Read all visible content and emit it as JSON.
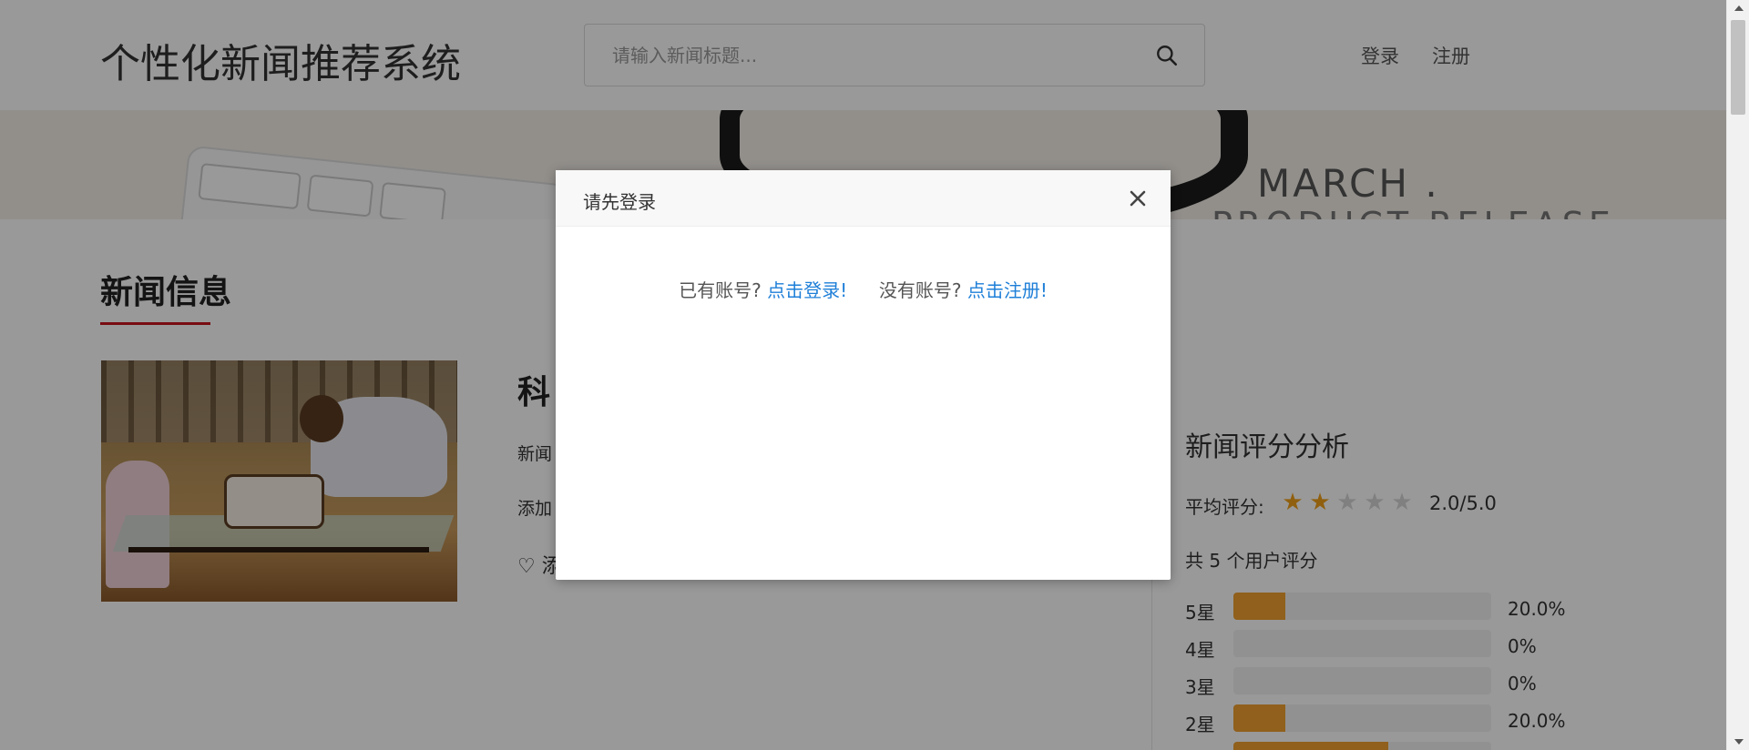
{
  "header": {
    "site_title": "个性化新闻推荐系统",
    "search_placeholder": "请输入新闻标题...",
    "nav": {
      "login": "登录",
      "register": "注册"
    }
  },
  "banner": {
    "line1": "MARCH .",
    "line2": "PRODUCT RELEASE"
  },
  "main": {
    "section_title": "新闻信息",
    "headline_partial": "科",
    "meta1_partial": "新闻",
    "meta2_partial": "添加",
    "favorite_partial": "♡ 添"
  },
  "sidebar": {
    "title": "新闻评分分析",
    "avg_label": "平均评分:",
    "avg_score": 2,
    "max_score": 5,
    "avg_value": "2.0/5.0",
    "user_count": "共 5 个用户评分",
    "distribution": [
      {
        "label": "5星",
        "fraction": 0.2,
        "pct": "20.0%"
      },
      {
        "label": "4星",
        "fraction": 0.0,
        "pct": "0%"
      },
      {
        "label": "3星",
        "fraction": 0.0,
        "pct": "0%"
      },
      {
        "label": "2星",
        "fraction": 0.2,
        "pct": "20.0%"
      },
      {
        "label": "",
        "fraction": 0.6,
        "pct": ""
      }
    ]
  },
  "modal": {
    "title": "请先登录",
    "has_account": "已有账号?",
    "login_link": "点击登录!",
    "no_account": "没有账号?",
    "register_link": "点击注册!"
  },
  "colors": {
    "accent_red": "#c9171e",
    "link_blue": "#1e7fd8",
    "star_gold": "#f0a01a",
    "bar_fill": "#f0a030"
  }
}
